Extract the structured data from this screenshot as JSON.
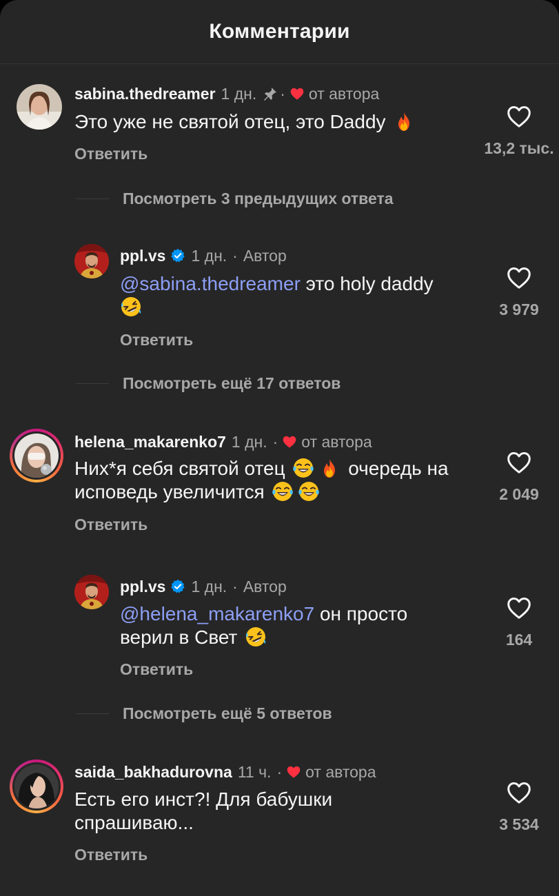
{
  "header": {
    "title": "Комментарии"
  },
  "comments": [
    {
      "username": "sabina.thedreamer",
      "time": "1 дн.",
      "sep": "·",
      "author_tag": "от автора",
      "text_before": "Это уже не святой отец, это Daddy",
      "reply_label": "Ответить",
      "likes": "13,2 тыс."
    },
    {
      "username": "ppl.vs",
      "time": "1 дн.",
      "sep": "·",
      "author_tag": "Автор",
      "mention": "@sabina.thedreamer",
      "text_before": " это holy daddy",
      "reply_label": "Ответить",
      "likes": "3 979"
    },
    {
      "username": "helena_makarenko7",
      "time": "1 дн.",
      "sep": "·",
      "author_tag": "от автора",
      "text_before": "Них*я себя святой отец",
      "text_after": "очередь на исповедь увеличится",
      "reply_label": "Ответить",
      "likes": "2 049"
    },
    {
      "username": "ppl.vs",
      "time": "1 дн.",
      "sep": "·",
      "author_tag": "Автор",
      "mention": "@helena_makarenko7",
      "text_before": " он просто верил в Свет",
      "reply_label": "Ответить",
      "likes": "164"
    },
    {
      "username": "saida_bakhadurovna",
      "time": "11 ч.",
      "sep": "·",
      "author_tag": "от автора",
      "text_before": "Есть его инст?! Для бабушки спрашиваю...",
      "reply_label": "Ответить",
      "likes": "3 534"
    }
  ],
  "view_more": [
    "Посмотреть 3 предыдущих ответа",
    "Посмотреть ещё 17 ответов",
    "Посмотреть ещё 5 ответов"
  ],
  "colors": {
    "background": "#262626",
    "text": "#f5f5f5",
    "muted": "#a8a8a8",
    "mention": "#8d9ff5",
    "heart_red": "#ff3040",
    "verified_blue": "#0095f6"
  },
  "icons": [
    "pin-icon",
    "heart-filled-icon",
    "verified-icon",
    "like-heart-icon",
    "fire-emoji",
    "rofl-emoji",
    "joy-emoji"
  ]
}
